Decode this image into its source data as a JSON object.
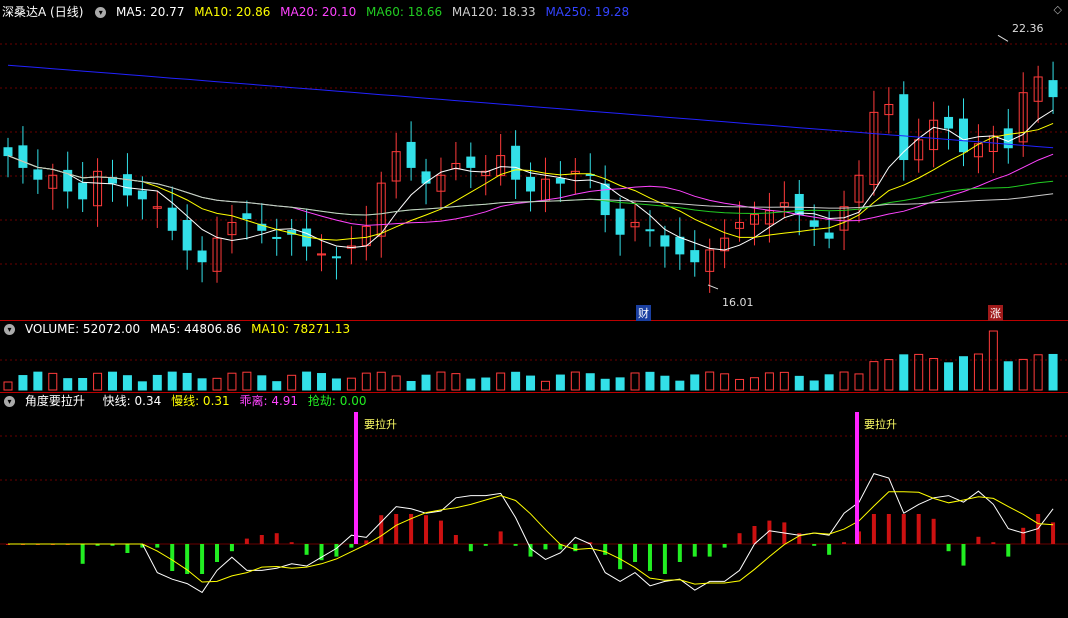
{
  "price_header": {
    "title": "深桑达A (日线)",
    "ma5": "MA5: 20.77",
    "ma10": "MA10: 20.86",
    "ma20": "MA20: 20.10",
    "ma60": "MA60: 18.66",
    "ma120": "MA120: 18.33",
    "ma250": "MA250: 19.28"
  },
  "volume_header": {
    "label": "VOLUME: 52072.00",
    "ma5": "MA5: 44806.86",
    "ma10": "MA10: 78271.13"
  },
  "indicator_header": {
    "name": "角度要拉升",
    "fast": "快线: 0.34",
    "slow": "慢线: 0.31",
    "deviation": "乖离: 4.91",
    "rally": "抢劫: 0.00"
  },
  "annotations": {
    "high": "22.36",
    "low": "16.01",
    "tag_finance": "财",
    "tag_rise": "涨",
    "signal": "要拉升"
  },
  "colors": {
    "up": "#ff3b3b",
    "down": "#33e0e8",
    "ma5": "#ffffff",
    "ma10": "#ffff00",
    "ma20": "#ff44ff",
    "ma60": "#22cc22",
    "ma120": "#cccccc",
    "ma250": "#2222ff",
    "fast": "#ffffff",
    "slow": "#ffff00",
    "bar_pos": "#cc1111",
    "bar_neg": "#22ee22",
    "signal": "#ff22ff"
  },
  "chart_data": {
    "type": "candlestick",
    "price_range": [
      15.5,
      22.8
    ],
    "high": 22.36,
    "low": 16.01,
    "close": [
      19.3,
      19.0,
      18.7,
      18.8,
      18.4,
      18.2,
      18.9,
      18.6,
      18.3,
      18.2,
      18.0,
      17.4,
      16.9,
      16.6,
      17.2,
      17.6,
      17.7,
      17.4,
      17.2,
      17.3,
      17.0,
      16.8,
      16.7,
      17.0,
      17.5,
      18.6,
      19.4,
      19.0,
      18.6,
      18.8,
      19.1,
      19.0,
      18.9,
      19.3,
      18.7,
      18.4,
      18.7,
      18.6,
      18.9,
      18.8,
      17.8,
      17.3,
      17.6,
      17.4,
      17.0,
      16.8,
      16.6,
      16.9,
      17.2,
      17.6,
      17.8,
      17.9,
      18.1,
      17.8,
      17.5,
      17.2,
      18.0,
      18.8,
      20.4,
      20.6,
      19.2,
      19.7,
      20.2,
      20.0,
      19.4,
      19.6,
      19.8,
      19.5,
      20.9,
      21.3,
      20.8
    ],
    "volume_label": 52072.0
  }
}
